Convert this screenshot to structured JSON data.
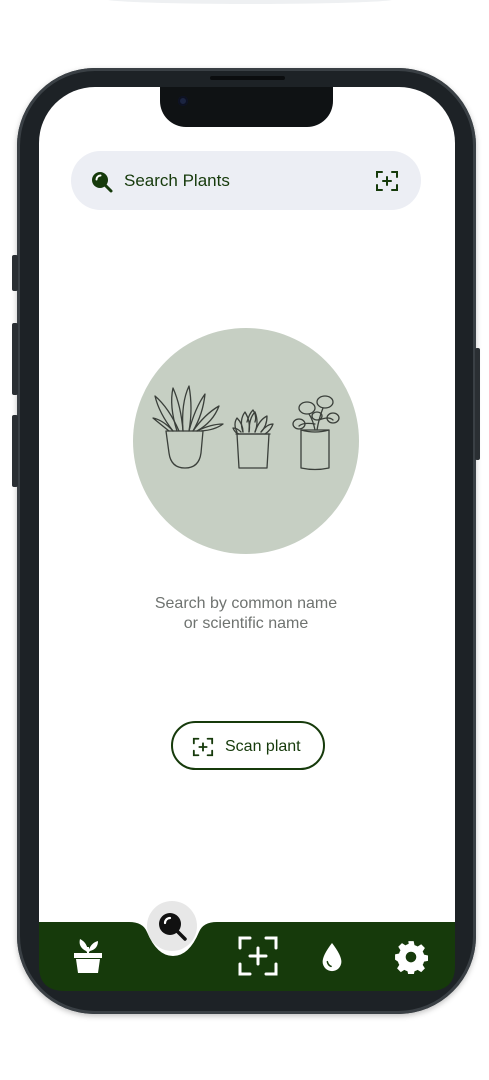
{
  "search": {
    "label": "Search Plants",
    "icon": "search-icon",
    "scan_icon": "scan-icon"
  },
  "empty_state": {
    "illustration": "potted-plants-illustration",
    "line1": "Search by common name",
    "line2": "or scientific name"
  },
  "scan_button": {
    "label": "Scan plant",
    "icon": "scan-icon"
  },
  "nav": {
    "items": [
      {
        "name": "my-plants",
        "icon": "plant-pot-icon"
      },
      {
        "name": "search",
        "icon": "search-icon",
        "active": true
      },
      {
        "name": "scan",
        "icon": "scan-icon"
      },
      {
        "name": "watering",
        "icon": "water-drop-icon"
      },
      {
        "name": "settings",
        "icon": "gear-icon"
      }
    ]
  },
  "colors": {
    "brand_dark_green": "#163a0b",
    "search_bar_bg": "#eceef4",
    "illustration_bg": "#c6cfc3",
    "active_tab_bg": "#e7e7e7"
  }
}
